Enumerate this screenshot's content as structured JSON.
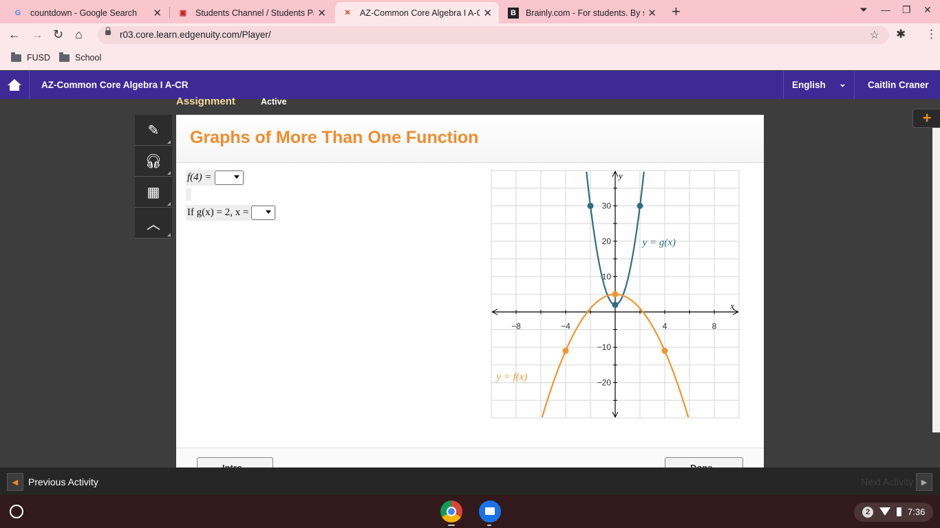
{
  "browser": {
    "tabs": [
      {
        "title": "countdown - Google Search",
        "icon": "google-icon"
      },
      {
        "title": "Students Channel / Students Pa",
        "icon": "fusd-icon"
      },
      {
        "title": "AZ-Common Core Algebra I A-CR",
        "icon": "edgenuity-icon"
      },
      {
        "title": "Brainly.com - For students. By st",
        "icon": "brainly-icon"
      }
    ],
    "url": "r03.core.learn.edgenuity.com/Player/",
    "bookmarks": [
      {
        "label": "FUSD"
      },
      {
        "label": "School"
      }
    ]
  },
  "app": {
    "course_title": "AZ-Common Core Algebra I A-CR",
    "language": "English",
    "user_name": "Caitlin Craner",
    "assignment_label": "Assignment",
    "status_label": "Active"
  },
  "content": {
    "title": "Graphs of More Than One Function",
    "q1_prefix": "f(4) =",
    "q2_prefix": "If g(x) = 2, x =",
    "intro_button": "Intro",
    "done_button": "Done"
  },
  "graph": {
    "x_label": "x",
    "y_label": "y",
    "x_ticks": [
      "−8",
      "−4",
      "4",
      "8"
    ],
    "y_ticks": [
      "30",
      "20",
      "10",
      "−10",
      "−20"
    ],
    "g_label": "y = g(x)",
    "f_label": "y = f(x)",
    "colors": {
      "g": "#2e6e7e",
      "f": "#f0952f"
    }
  },
  "chart_data": {
    "type": "line",
    "xlabel": "x",
    "ylabel": "y",
    "xlim": [
      -10,
      10
    ],
    "ylim": [
      -30,
      40
    ],
    "grid": true,
    "series": [
      {
        "name": "y = g(x)",
        "points": [
          [
            -2,
            30
          ],
          [
            0,
            2
          ],
          [
            2,
            30
          ]
        ]
      },
      {
        "name": "y = f(x)",
        "points": [
          [
            -4,
            -11
          ],
          [
            0,
            5
          ],
          [
            4,
            -11
          ]
        ]
      }
    ]
  },
  "activity": {
    "previous_label": "Previous Activity",
    "next_label": "Next Activity"
  },
  "shelf": {
    "notification_count": "2",
    "time": "7:36"
  }
}
